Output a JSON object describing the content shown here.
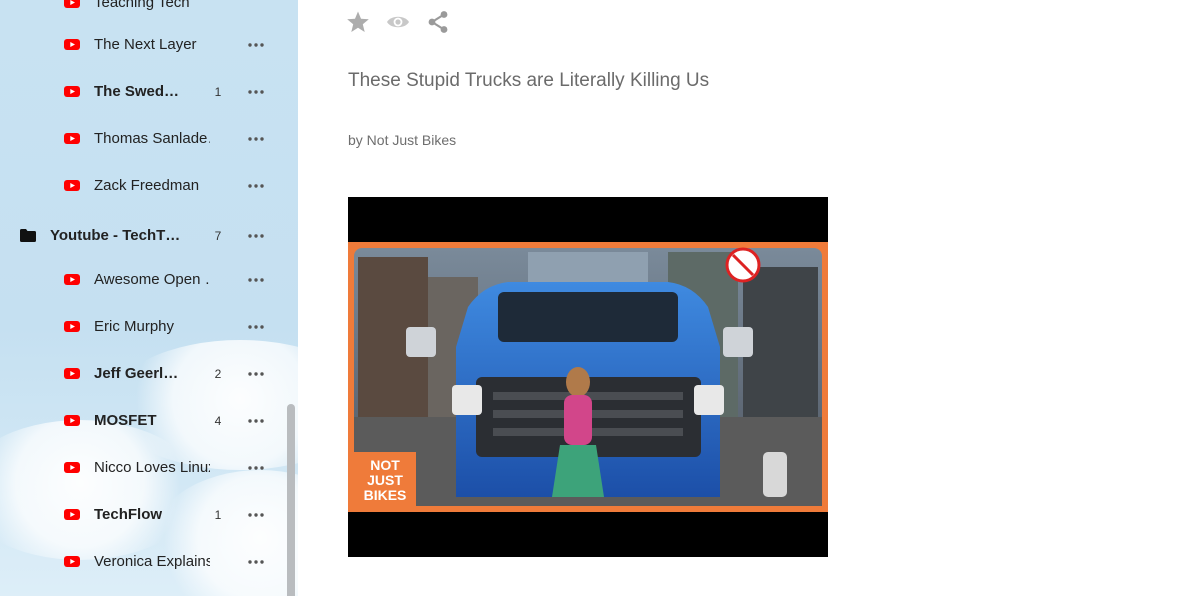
{
  "sidebar": {
    "partial_top_label": "Teaching Tech",
    "items": [
      {
        "label": "The Next Layer",
        "count": "",
        "bold": false,
        "type": "feed"
      },
      {
        "label": "The Swed…",
        "count": "1",
        "bold": true,
        "type": "feed"
      },
      {
        "label": "Thomas Sanlade…",
        "count": "",
        "bold": false,
        "type": "feed"
      },
      {
        "label": "Zack Freedman",
        "count": "",
        "bold": false,
        "type": "feed"
      },
      {
        "label": "Youtube - TechT…",
        "count": "7",
        "bold": true,
        "type": "folder"
      },
      {
        "label": "Awesome Open …",
        "count": "",
        "bold": false,
        "type": "feed"
      },
      {
        "label": "Eric Murphy",
        "count": "",
        "bold": false,
        "type": "feed"
      },
      {
        "label": "Jeff Geerl…",
        "count": "2",
        "bold": true,
        "type": "feed"
      },
      {
        "label": "MOSFET",
        "count": "4",
        "bold": true,
        "type": "feed"
      },
      {
        "label": "Nicco Loves Linux",
        "count": "",
        "bold": false,
        "type": "feed"
      },
      {
        "label": "TechFlow",
        "count": "1",
        "bold": true,
        "type": "feed"
      },
      {
        "label": "Veronica Explains",
        "count": "",
        "bold": false,
        "type": "feed"
      }
    ],
    "feed_icon": "youtube-icon",
    "folder_icon": "folder-icon",
    "more_icon": "more-horizontal-icon"
  },
  "article": {
    "actions": [
      "star-icon",
      "eye-icon",
      "share-icon"
    ],
    "title": "These Stupid Trucks are Literally Killing Us",
    "byline": "by Not Just Bikes",
    "thumbnail_logo": "NOT JUST BIKES"
  },
  "colors": {
    "youtube_red": "#ff0000",
    "sidebar_bg": "#c8e2f2",
    "accent_orange": "#ef7b3a"
  }
}
